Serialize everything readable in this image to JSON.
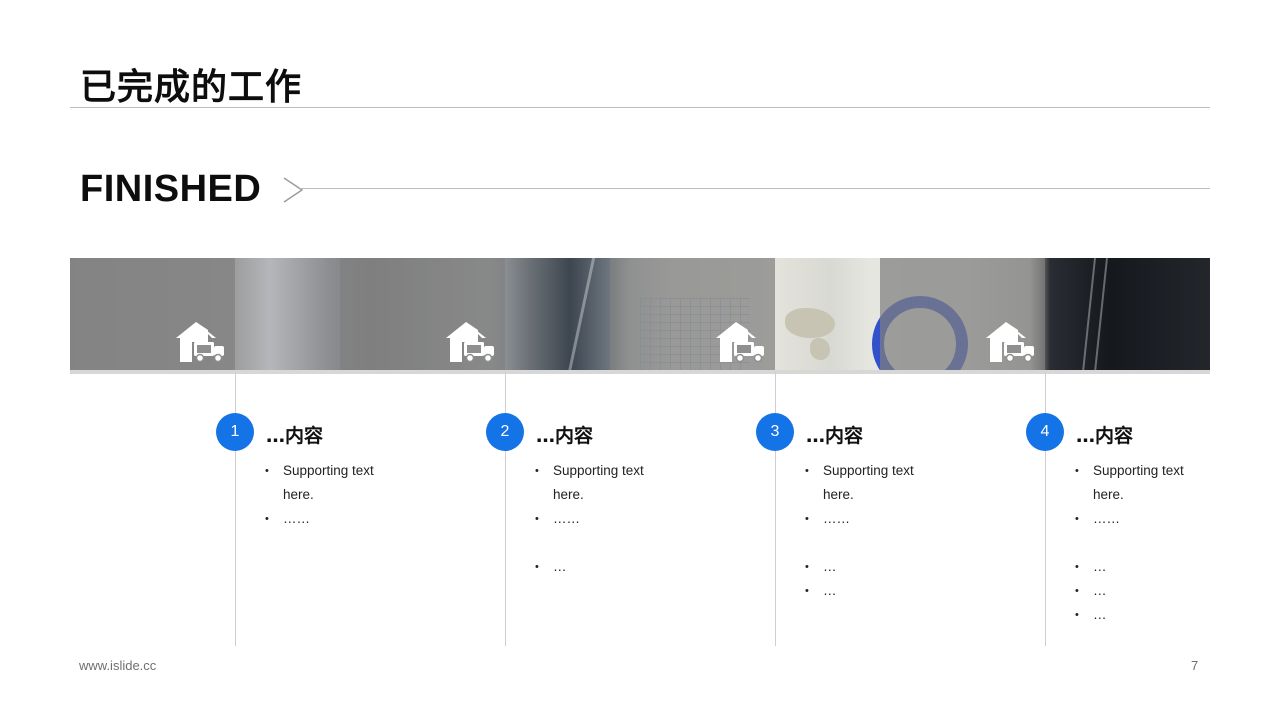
{
  "header": {
    "title": "已完成的工作"
  },
  "section": {
    "heading": "FINISHED"
  },
  "icons": {
    "step_icon": "house-with-truck-icon",
    "arrow": "chevron-right-icon"
  },
  "colors": {
    "accent": "#1473e6",
    "rule": "#bdbdbd",
    "text": "#111111"
  },
  "steps": [
    {
      "number": "1",
      "title": "…内容",
      "bullets": [
        "Supporting text here.",
        "……"
      ]
    },
    {
      "number": "2",
      "title": "…内容",
      "bullets": [
        "Supporting text here.",
        "……",
        "…"
      ]
    },
    {
      "number": "3",
      "title": "…内容",
      "bullets": [
        "Supporting text here.",
        "……",
        "…",
        "…"
      ]
    },
    {
      "number": "4",
      "title": "…内容",
      "bullets": [
        "Supporting text here.",
        "……",
        "…",
        "…",
        "…"
      ]
    }
  ],
  "footer": {
    "url": "www.islide.cc",
    "page_number": "7"
  }
}
